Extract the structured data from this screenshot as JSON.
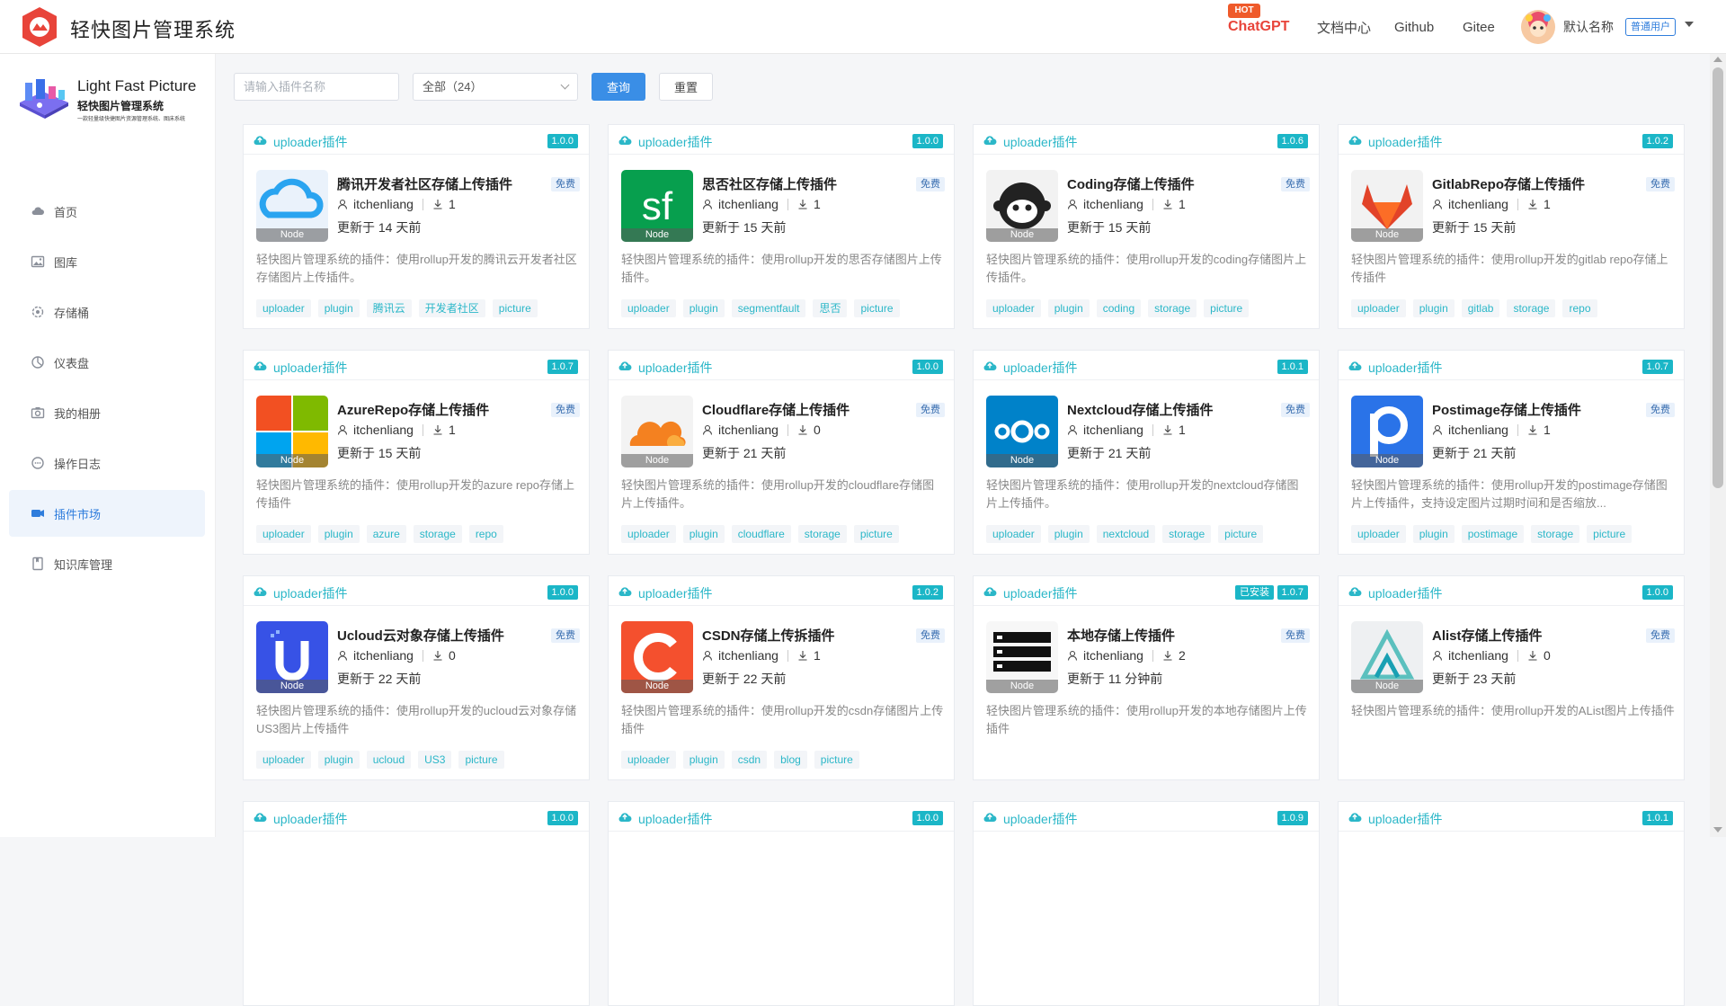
{
  "header": {
    "title": "轻快图片管理系统",
    "hot_badge": "HOT",
    "nav": {
      "chatgpt": "ChatGPT",
      "docs": "文档中心",
      "github": "Github",
      "gitee": "Gitee"
    },
    "user": {
      "name": "默认名称",
      "role": "普通用户"
    }
  },
  "brand": {
    "en": "Light Fast Picture",
    "cn": "轻快图片管理系统",
    "sub": "一款轻量级快捷图片资源管理系统、图床系统"
  },
  "sidebar": {
    "items": [
      {
        "label": "首页",
        "icon": "cloud-icon"
      },
      {
        "label": "图库",
        "icon": "image-icon"
      },
      {
        "label": "存储桶",
        "icon": "gear-icon"
      },
      {
        "label": "仪表盘",
        "icon": "pie-chart-icon"
      },
      {
        "label": "我的相册",
        "icon": "camera-icon"
      },
      {
        "label": "操作日志",
        "icon": "chat-icon"
      },
      {
        "label": "插件市场",
        "icon": "plugin-icon"
      },
      {
        "label": "知识库管理",
        "icon": "book-icon"
      }
    ],
    "active_index": 6
  },
  "toolbar": {
    "search_placeholder": "请输入插件名称",
    "filter_value": "全部（24）",
    "query_label": "查询",
    "reset_label": "重置"
  },
  "common": {
    "category": "uploader插件",
    "free": "免费",
    "node": "Node",
    "installed": "已安装"
  },
  "plugins": [
    {
      "name": "腾讯开发者社区存储上传插件",
      "version": "1.0.0",
      "author": "itchenliang",
      "downloads": "1",
      "updated": "更新于 14 天前",
      "desc": "轻快图片管理系统的插件：使用rollup开发的腾讯云开发者社区存储图片上传插件。",
      "tags": [
        "uploader",
        "plugin",
        "腾讯云",
        "开发者社区",
        "picture"
      ],
      "logo": "tencent"
    },
    {
      "name": "思否社区存储上传插件",
      "version": "1.0.0",
      "author": "itchenliang",
      "downloads": "1",
      "updated": "更新于 15 天前",
      "desc": "轻快图片管理系统的插件：使用rollup开发的思否存储图片上传插件。",
      "tags": [
        "uploader",
        "plugin",
        "segmentfault",
        "思否",
        "picture"
      ],
      "logo": "sf"
    },
    {
      "name": "Coding存储上传插件",
      "version": "1.0.6",
      "author": "itchenliang",
      "downloads": "1",
      "updated": "更新于 15 天前",
      "desc": "轻快图片管理系统的插件：使用rollup开发的coding存储图片上传插件。",
      "tags": [
        "uploader",
        "plugin",
        "coding",
        "storage",
        "picture"
      ],
      "logo": "coding"
    },
    {
      "name": "GitlabRepo存储上传插件",
      "version": "1.0.2",
      "author": "itchenliang",
      "downloads": "1",
      "updated": "更新于 15 天前",
      "desc": "轻快图片管理系统的插件：使用rollup开发的gitlab repo存储上传插件",
      "tags": [
        "uploader",
        "plugin",
        "gitlab",
        "storage",
        "repo"
      ],
      "logo": "gitlab"
    },
    {
      "name": "AzureRepo存储上传插件",
      "version": "1.0.7",
      "author": "itchenliang",
      "downloads": "1",
      "updated": "更新于 15 天前",
      "desc": "轻快图片管理系统的插件：使用rollup开发的azure repo存储上传插件",
      "tags": [
        "uploader",
        "plugin",
        "azure",
        "storage",
        "repo"
      ],
      "logo": "azure"
    },
    {
      "name": "Cloudflare存储上传插件",
      "version": "1.0.0",
      "author": "itchenliang",
      "downloads": "0",
      "updated": "更新于 21 天前",
      "desc": "轻快图片管理系统的插件：使用rollup开发的cloudflare存储图片上传插件。",
      "tags": [
        "uploader",
        "plugin",
        "cloudflare",
        "storage",
        "picture"
      ],
      "logo": "cloudflare"
    },
    {
      "name": "Nextcloud存储上传插件",
      "version": "1.0.1",
      "author": "itchenliang",
      "downloads": "1",
      "updated": "更新于 21 天前",
      "desc": "轻快图片管理系统的插件：使用rollup开发的nextcloud存储图片上传插件。",
      "tags": [
        "uploader",
        "plugin",
        "nextcloud",
        "storage",
        "picture"
      ],
      "logo": "nextcloud"
    },
    {
      "name": "Postimage存储上传插件",
      "version": "1.0.7",
      "author": "itchenliang",
      "downloads": "1",
      "updated": "更新于 21 天前",
      "desc": "轻快图片管理系统的插件：使用rollup开发的postimage存储图片上传插件，支持设定图片过期时间和是否缩放...",
      "tags": [
        "uploader",
        "plugin",
        "postimage",
        "storage",
        "picture"
      ],
      "logo": "postimage"
    },
    {
      "name": "Ucloud云对象存储上传插件",
      "version": "1.0.0",
      "author": "itchenliang",
      "downloads": "0",
      "updated": "更新于 22 天前",
      "desc": "轻快图片管理系统的插件：使用rollup开发的ucloud云对象存储US3图片上传插件",
      "tags": [
        "uploader",
        "plugin",
        "ucloud",
        "US3",
        "picture"
      ],
      "logo": "ucloud"
    },
    {
      "name": "CSDN存储上传拆插件",
      "version": "1.0.2",
      "author": "itchenliang",
      "downloads": "1",
      "updated": "更新于 22 天前",
      "desc": "轻快图片管理系统的插件：使用rollup开发的csdn存储图片上传插件",
      "tags": [
        "uploader",
        "plugin",
        "csdn",
        "blog",
        "picture"
      ],
      "logo": "csdn"
    },
    {
      "name": "本地存储上传插件",
      "version": "1.0.7",
      "installed": true,
      "author": "itchenliang",
      "downloads": "2",
      "updated": "更新于 11 分钟前",
      "desc": "轻快图片管理系统的插件：使用rollup开发的本地存储图片上传插件",
      "tags": [],
      "logo": "local"
    },
    {
      "name": "Alist存储上传插件",
      "version": "1.0.0",
      "author": "itchenliang",
      "downloads": "0",
      "updated": "更新于 23 天前",
      "desc": "轻快图片管理系统的插件：使用rollup开发的AList图片上传插件",
      "tags": [],
      "logo": "alist"
    },
    {
      "version": "1.0.0"
    },
    {
      "version": "1.0.0"
    },
    {
      "version": "1.0.9"
    },
    {
      "version": "1.0.1"
    }
  ]
}
